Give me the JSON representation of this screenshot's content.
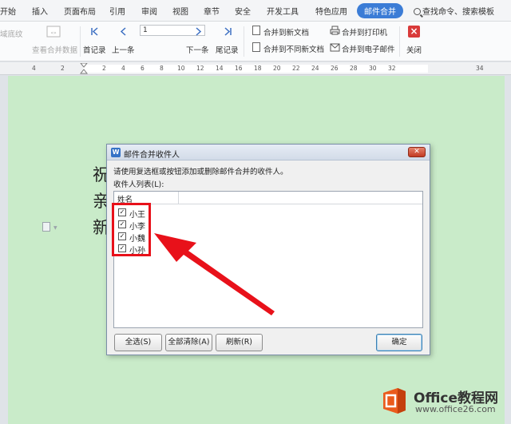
{
  "menubar": {
    "items": [
      "开始",
      "插入",
      "页面布局",
      "引用",
      "审阅",
      "视图",
      "章节",
      "安全",
      "开发工具",
      "特色应用",
      "邮件合并"
    ],
    "active_index": 10,
    "search_label": "查找命令、搜索模板"
  },
  "toolbar": {
    "left_fragment": "域底纹",
    "view_merged_data": "查看合并数据",
    "first_record": "首记录",
    "prev_record": "上一条",
    "record_input_value": "1",
    "next_record": "下一条",
    "last_record": "尾记录",
    "merge_to_new_doc": "合并到新文档",
    "merge_to_diff_docs": "合并到不同新文档",
    "merge_to_printer": "合并到打印机",
    "merge_to_email": "合并到电子邮件",
    "close": "关闭"
  },
  "ruler": {
    "ticks": [
      "4",
      "2",
      "2",
      "4",
      "6",
      "8",
      "10",
      "12",
      "14",
      "16",
      "18",
      "20",
      "22",
      "24",
      "26",
      "28",
      "30",
      "32",
      "34"
    ]
  },
  "document": {
    "lines": [
      "祝：",
      "亲爱",
      "新春"
    ]
  },
  "dialog": {
    "title": "邮件合并收件人",
    "logo_letter": "W",
    "instruction": "请使用复选框或按钮添加或删除邮件合并的收件人。",
    "list_label": "收件人列表(L):",
    "column_header": "姓名",
    "recipients": [
      {
        "name": "小王",
        "checked": true
      },
      {
        "name": "小李",
        "checked": true
      },
      {
        "name": "小魏",
        "checked": true
      },
      {
        "name": "小孙",
        "checked": true
      }
    ],
    "buttons": {
      "select_all": "全选(S)",
      "clear_all": "全部清除(A)",
      "refresh": "刷新(R)",
      "ok": "确定"
    }
  },
  "colors": {
    "accent": "#3b7cd6",
    "page_bg": "#c9ebc9",
    "annotation_red": "#e8111a"
  },
  "watermark": {
    "title": "Office教程网",
    "url": "www.office26.com"
  }
}
